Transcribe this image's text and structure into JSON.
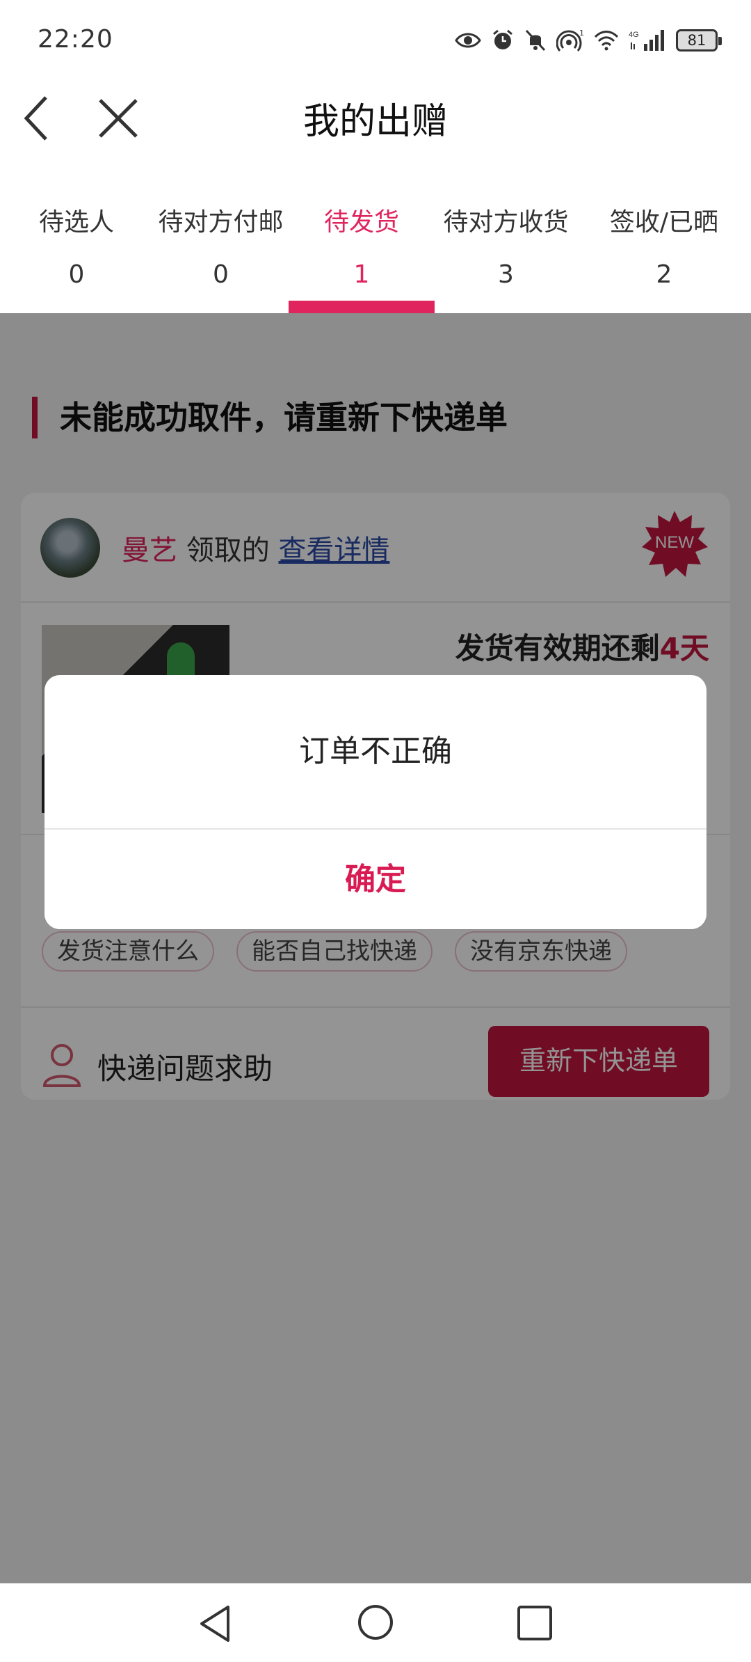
{
  "status_bar": {
    "time": "22:20",
    "battery": "81",
    "icons": [
      "eye-icon",
      "alarm-icon",
      "mute-icon",
      "hotspot-icon",
      "wifi-icon",
      "signal-4g-icon",
      "battery-icon"
    ]
  },
  "header": {
    "title": "我的出赠",
    "back_icon": "chevron-left-icon",
    "close_icon": "close-icon"
  },
  "tabs": [
    {
      "label": "待选人",
      "count": "0",
      "active": false
    },
    {
      "label": "待对方付邮",
      "count": "0",
      "active": false
    },
    {
      "label": "待发货",
      "count": "1",
      "active": true
    },
    {
      "label": "待对方收货",
      "count": "3",
      "active": false
    },
    {
      "label": "签收/已晒",
      "count": "2",
      "active": false
    }
  ],
  "section": {
    "heading": "未能成功取件，请重新下快递单"
  },
  "card": {
    "giver_name": "曼艺",
    "claimed_text": "领取的",
    "detail_link": "查看详情",
    "badge": "NEW",
    "expiry_prefix": "发货有效期还剩",
    "expiry_days": "4天",
    "faq_chips": [
      "发货注意什么",
      "能否自己找快递",
      "没有京东快递"
    ],
    "help_label": "快递问题求助",
    "reorder_button": "重新下快递单"
  },
  "dialog": {
    "message": "订单不正确",
    "confirm": "确定"
  },
  "colors": {
    "accent": "#e0245e",
    "brand_dark": "#c2183f",
    "overlay": "#000000"
  }
}
